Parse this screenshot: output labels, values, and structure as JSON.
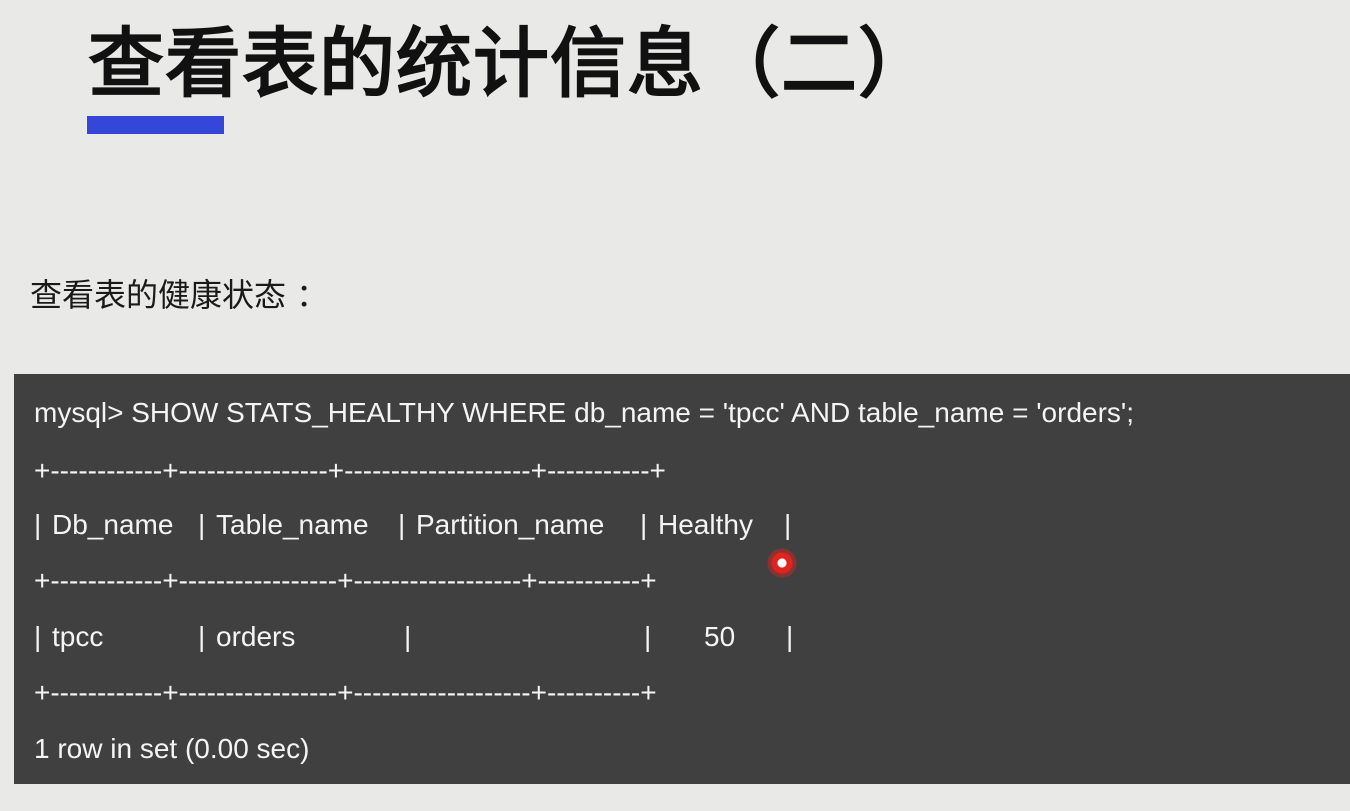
{
  "slide": {
    "title": "查看表的统计信息（二）",
    "subtitle": "查看表的健康状态 ：",
    "accent_color": "#3447d8"
  },
  "terminal": {
    "background": "#3f403f",
    "command": "mysql> SHOW STATS_HEALTHY WHERE db_name = 'tpcc' AND table_name = 'orders';",
    "border_top": "+------------+----------------+--------------------+-----------+",
    "border_mid": "+------------+-----------------+------------------+-----------+",
    "border_bottom": "+------------+-----------------+-------------------+----------+",
    "columns": [
      "Db_name",
      "Table_name",
      "Partition_name",
      "Healthy"
    ],
    "rows": [
      [
        "tpcc",
        "orders",
        "",
        "50"
      ]
    ],
    "result_summary": "1 row in set (0.00 sec)"
  },
  "cursor": {
    "icon": "red-pointer-dot-icon",
    "color": "#e0231f"
  }
}
